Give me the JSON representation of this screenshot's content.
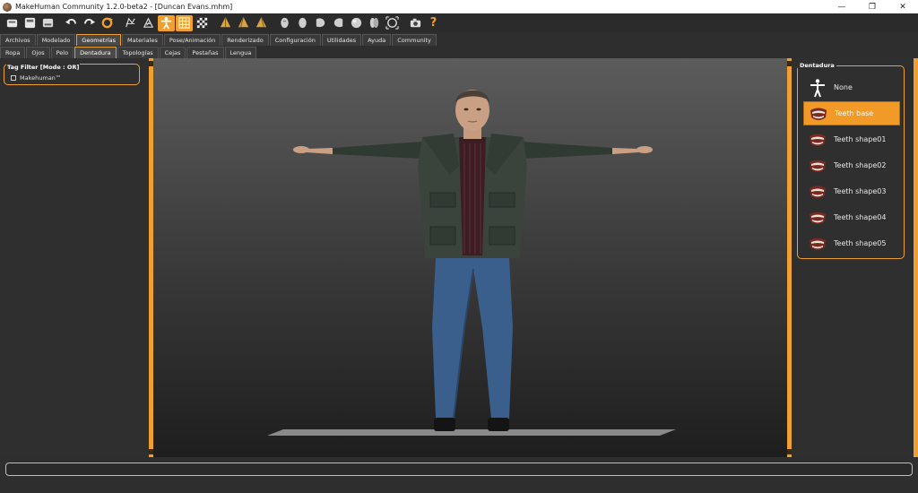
{
  "window": {
    "title": "MakeHuman Community 1.2.0-beta2 - [Duncan Evans.mhm]",
    "minimize": "—",
    "restore": "❐",
    "close": "✕"
  },
  "toolbar": {
    "icons": [
      "save-icon",
      "load-icon",
      "export-icon",
      "undo-icon",
      "redo-icon",
      "reset-icon",
      "wireframe-icon",
      "smooth-icon",
      "pose-icon",
      "grid-icon",
      "checker-icon",
      "front-view-icon",
      "side-view-icon",
      "top-view-icon",
      "face-view-icon",
      "back-view-icon",
      "left-view-icon",
      "right-view-icon",
      "sphere-icon",
      "shell-icon",
      "frame-icon",
      "screenshot-icon",
      "help-icon"
    ],
    "active": [
      "pose-icon",
      "grid-icon"
    ],
    "help_label": "?"
  },
  "main_tabs": [
    {
      "label": "Archivos",
      "active": false
    },
    {
      "label": "Modelado",
      "active": false
    },
    {
      "label": "Geometrías",
      "active": true
    },
    {
      "label": "Materiales",
      "active": false
    },
    {
      "label": "Pose/Animación",
      "active": false
    },
    {
      "label": "Renderizado",
      "active": false
    },
    {
      "label": "Configuración",
      "active": false
    },
    {
      "label": "Utilidades",
      "active": false
    },
    {
      "label": "Ayuda",
      "active": false
    },
    {
      "label": "Community",
      "active": false
    }
  ],
  "sub_tabs": [
    {
      "label": "Ropa",
      "active": false
    },
    {
      "label": "Ojos",
      "active": false
    },
    {
      "label": "Pelo",
      "active": false
    },
    {
      "label": "Dentadura",
      "active": true
    },
    {
      "label": "Topologías",
      "active": false
    },
    {
      "label": "Cejas",
      "active": false
    },
    {
      "label": "Pestañas",
      "active": false
    },
    {
      "label": "Lengua",
      "active": false
    }
  ],
  "tag_filter": {
    "title": "Tag Filter [Mode : OR]",
    "option": "Makehuman™",
    "checked": false
  },
  "dentadura": {
    "title": "Dentadura",
    "options": [
      {
        "label": "None",
        "icon": "human-figure-icon",
        "selected": false
      },
      {
        "label": "Teeth base",
        "icon": "teeth-icon",
        "selected": true
      },
      {
        "label": "Teeth shape01",
        "icon": "teeth-icon",
        "selected": false
      },
      {
        "label": "Teeth shape02",
        "icon": "teeth-icon",
        "selected": false
      },
      {
        "label": "Teeth shape03",
        "icon": "teeth-icon",
        "selected": false
      },
      {
        "label": "Teeth shape04",
        "icon": "teeth-icon",
        "selected": false
      },
      {
        "label": "Teeth shape05",
        "icon": "teeth-icon",
        "selected": false
      }
    ]
  },
  "colors": {
    "accent": "#f0a030",
    "background": "#2e2e2e",
    "selected": "#f29a28"
  },
  "status": {
    "text": ""
  }
}
